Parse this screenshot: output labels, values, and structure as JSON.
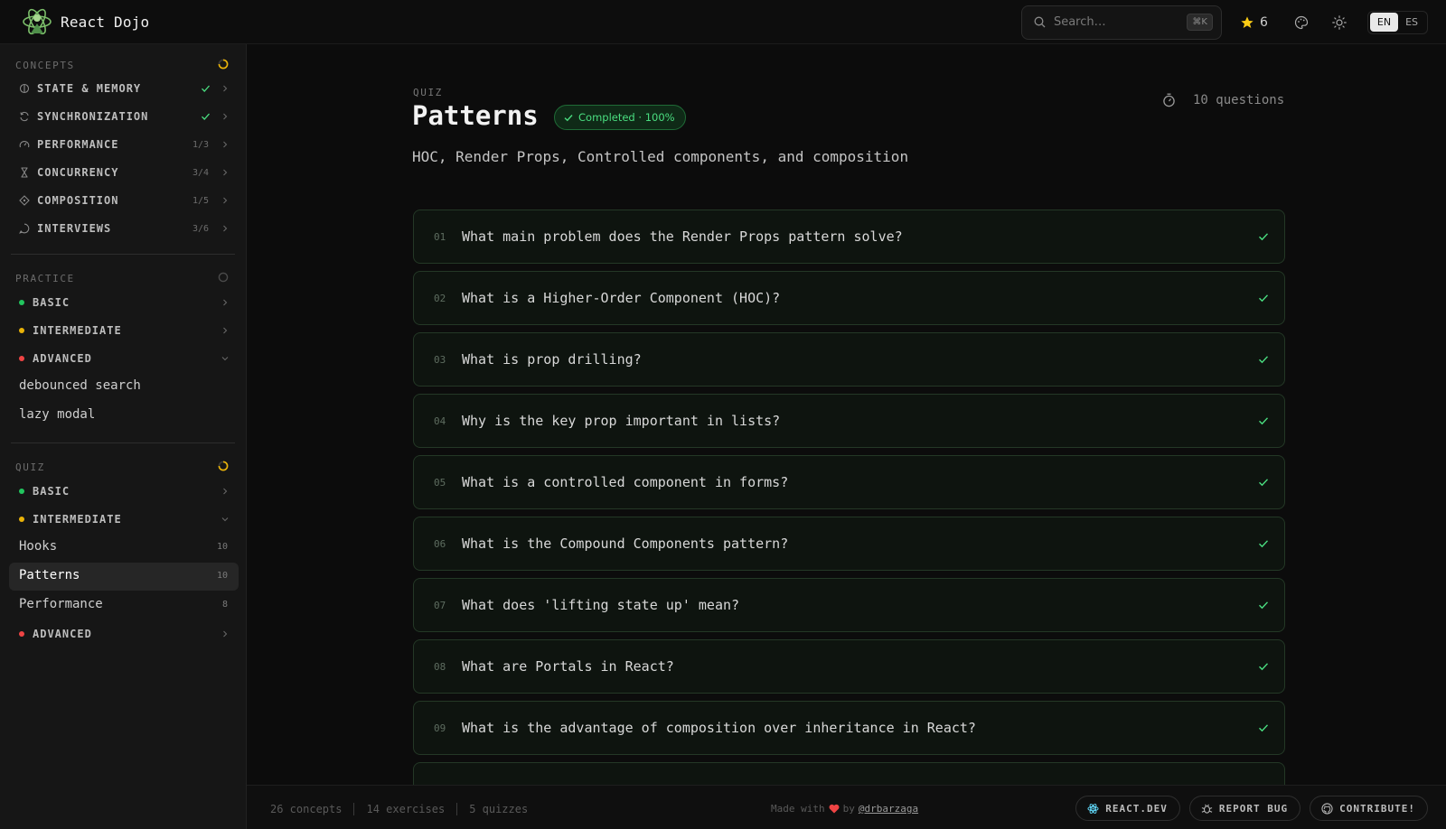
{
  "app": {
    "name": "React Dojo"
  },
  "header": {
    "search_placeholder": "Search…",
    "search_shortcut": "⌘K",
    "stars": "6",
    "languages": [
      "EN",
      "ES"
    ],
    "active_language": "EN"
  },
  "sidebar": {
    "concepts": {
      "title": "CONCEPTS",
      "items": [
        {
          "label": "STATE & MEMORY",
          "icon": "brain-icon",
          "done": true
        },
        {
          "label": "SYNCHRONIZATION",
          "icon": "sync-icon",
          "done": true
        },
        {
          "label": "PERFORMANCE",
          "icon": "gauge-icon",
          "progress": "1/3"
        },
        {
          "label": "CONCURRENCY",
          "icon": "hourglass-icon",
          "progress": "3/4"
        },
        {
          "label": "COMPOSITION",
          "icon": "puzzle-icon",
          "progress": "1/5"
        },
        {
          "label": "INTERVIEWS",
          "icon": "message-icon",
          "progress": "3/6"
        }
      ]
    },
    "practice": {
      "title": "PRACTICE",
      "levels": [
        "BASIC",
        "INTERMEDIATE",
        "ADVANCED"
      ],
      "advanced_items": [
        "debounced search",
        "lazy modal"
      ]
    },
    "quiz": {
      "title": "QUIZ",
      "levels": [
        "BASIC",
        "INTERMEDIATE",
        "ADVANCED"
      ],
      "intermediate_items": [
        {
          "label": "Hooks",
          "count": "10"
        },
        {
          "label": "Patterns",
          "count": "10"
        },
        {
          "label": "Performance",
          "count": "8"
        }
      ]
    }
  },
  "main": {
    "kicker": "QUIZ",
    "title": "Patterns",
    "badge": "Completed · 100%",
    "question_count": "10 questions",
    "subtitle": "HOC, Render Props, Controlled components, and composition",
    "questions": [
      {
        "num": "01",
        "text": "What main problem does the Render Props pattern solve?"
      },
      {
        "num": "02",
        "text": "What is a Higher-Order Component (HOC)?"
      },
      {
        "num": "03",
        "text": "What is prop drilling?"
      },
      {
        "num": "04",
        "text": "Why is the key prop important in lists?"
      },
      {
        "num": "05",
        "text": "What is a controlled component in forms?"
      },
      {
        "num": "06",
        "text": "What is the Compound Components pattern?"
      },
      {
        "num": "07",
        "text": "What does 'lifting state up' mean?"
      },
      {
        "num": "08",
        "text": "What are Portals in React?"
      },
      {
        "num": "09",
        "text": "What is the advantage of composition over inheritance in React?"
      }
    ]
  },
  "footer": {
    "concepts": "26 concepts",
    "exercises": "14 exercises",
    "quizzes": "5 quizzes",
    "made_with": "Made with",
    "by": "by",
    "author": "@drbarzaga",
    "buttons": [
      "REACT.DEV",
      "REPORT BUG",
      "CONTRIBUTE!"
    ]
  },
  "colors": {
    "accent_green": "#4ade80",
    "level_basic": "#22c55e",
    "level_intermediate": "#eab308",
    "level_advanced": "#ef4444",
    "progress_ring": "#eab308"
  }
}
